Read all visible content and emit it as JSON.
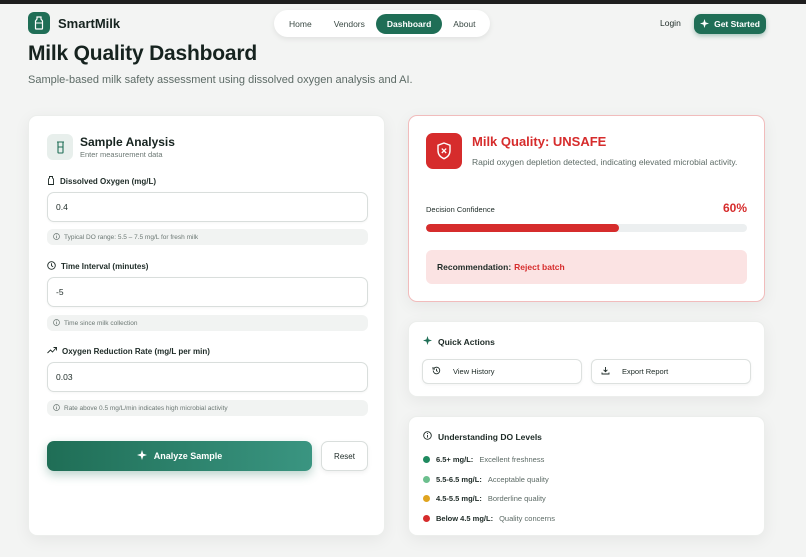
{
  "app": {
    "name": "SmartMilk"
  },
  "nav": {
    "items": [
      {
        "label": "Home"
      },
      {
        "label": "Vendors"
      },
      {
        "label": "Dashboard"
      },
      {
        "label": "About"
      }
    ],
    "active": "Dashboard",
    "login_label": "Login",
    "cta_label": "Get Started"
  },
  "page": {
    "title": "Milk Quality Dashboard",
    "subtitle": "Sample-based milk safety assessment using dissolved oxygen analysis and AI."
  },
  "sample_analysis": {
    "title": "Sample Analysis",
    "subtitle": "Enter measurement data",
    "fields": [
      {
        "label": "Dissolved Oxygen (mg/L)",
        "value": "0.4",
        "hint": "Typical DO range: 5.5 – 7.5 mg/L for fresh milk"
      },
      {
        "label": "Time Interval (minutes)",
        "value": "-5",
        "hint": "Time since milk collection"
      },
      {
        "label": "Oxygen Reduction Rate (mg/L per min)",
        "value": "0.03",
        "hint": "Rate above 0.5 mg/L/min indicates high microbial activity"
      }
    ],
    "analyze_label": "Analyze Sample",
    "reset_label": "Reset"
  },
  "result": {
    "title": "Milk Quality: UNSAFE",
    "description": "Rapid oxygen depletion detected, indicating elevated microbial activity.",
    "confidence_label": "Decision Confidence",
    "confidence_text": "60%",
    "confidence_value": 0.6,
    "recommendation_label": "Recommendation:",
    "recommendation_value": "Reject batch",
    "status_color": "#d62c2c"
  },
  "quick_actions": {
    "title": "Quick Actions",
    "buttons": [
      {
        "label": "View History",
        "icon": "history-icon"
      },
      {
        "label": "Export Report",
        "icon": "download-icon"
      }
    ]
  },
  "do_levels": {
    "title": "Understanding DO Levels",
    "items": [
      {
        "range": "6.5+ mg/L:",
        "desc": "Excellent freshness",
        "color": "#1f8a5f"
      },
      {
        "range": "5.5-6.5 mg/L:",
        "desc": "Acceptable quality",
        "color": "#6cbf8e"
      },
      {
        "range": "4.5-5.5 mg/L:",
        "desc": "Borderline quality",
        "color": "#e0a41f"
      },
      {
        "range": "Below 4.5 mg/L:",
        "desc": "Quality concerns",
        "color": "#d62c2c"
      }
    ]
  },
  "colors": {
    "brand": "#1f6e56",
    "danger": "#d62c2c"
  }
}
